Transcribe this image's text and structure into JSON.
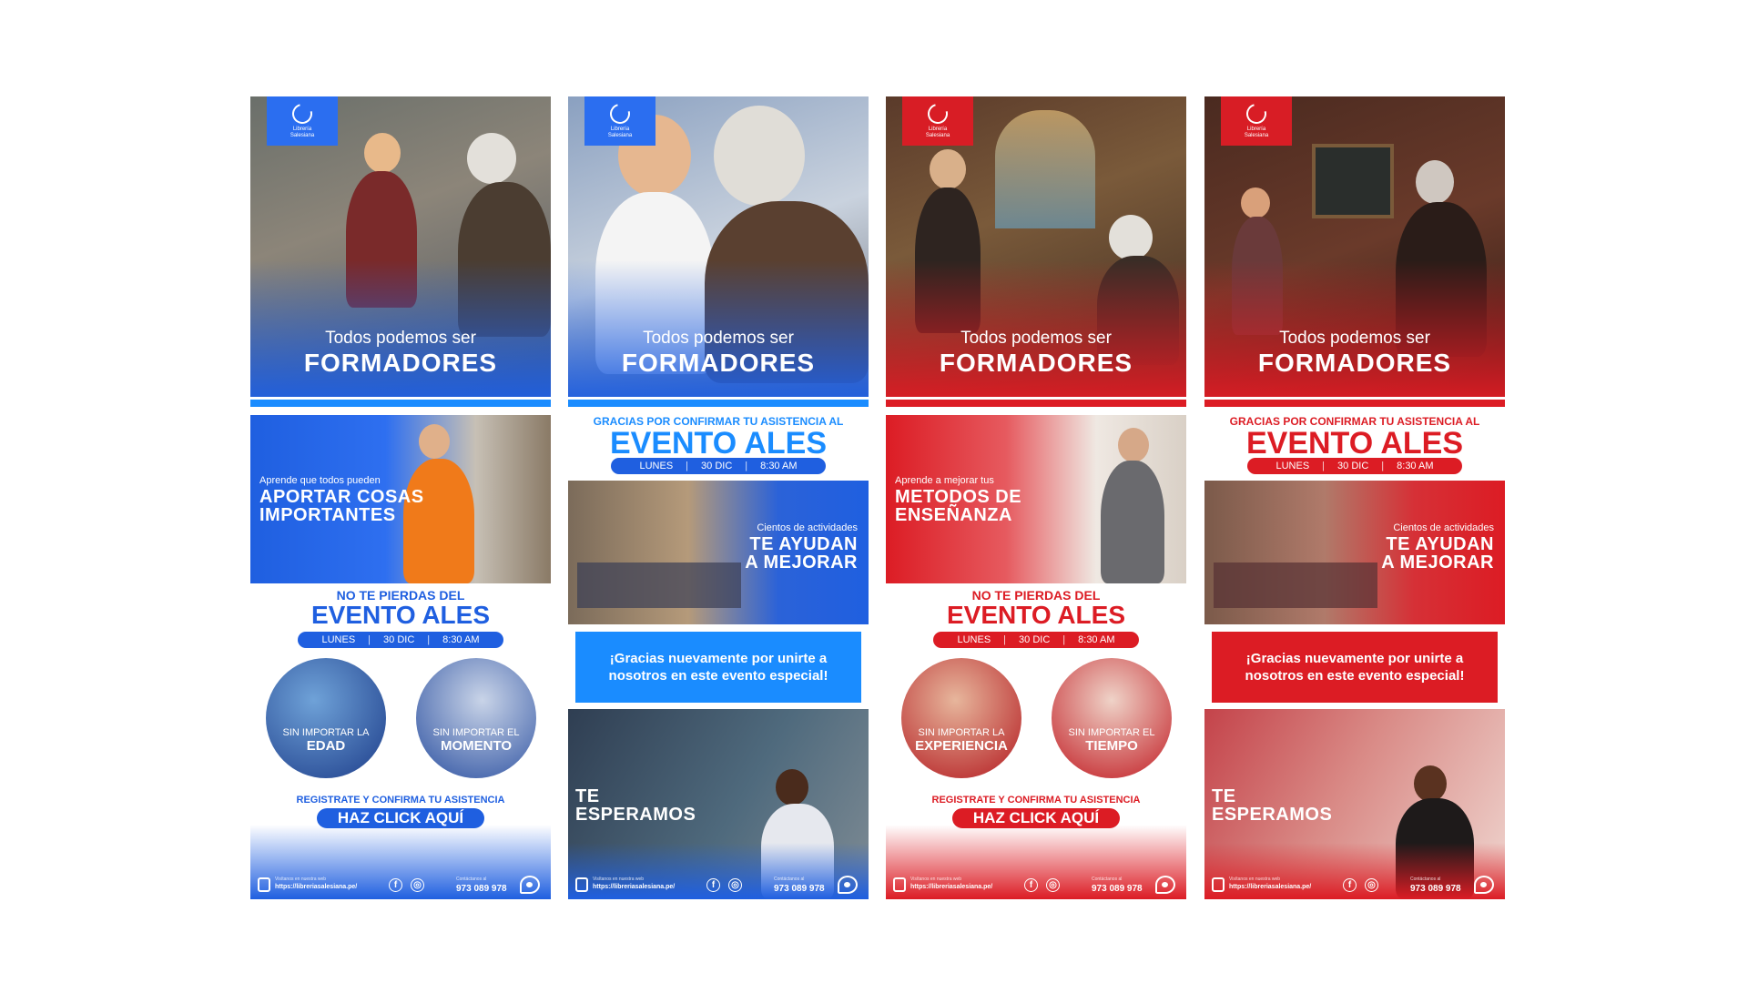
{
  "colors": {
    "blue": "#1f5fe0",
    "lightblue": "#1a8cff",
    "red": "#dc1c24",
    "white": "#ffffff"
  },
  "logo": {
    "line1": "Librería",
    "line2": "Salesiana"
  },
  "hero": {
    "sub": "Todos podemos ser",
    "big": "FORMADORES"
  },
  "col1": {
    "promo_small": "Aprende que todos pueden",
    "promo_big1": "APORTAR COSAS",
    "promo_big2": "IMPORTANTES",
    "event_pre": "NO TE PIERDAS DEL",
    "event_title": "EVENTO ALES",
    "day": "LUNES",
    "date": "30 DIC",
    "time": "8:30 AM",
    "circle1_small": "SIN IMPORTAR LA",
    "circle1_big": "EDAD",
    "circle2_small": "SIN IMPORTAR EL",
    "circle2_big": "MOMENTO",
    "register": "REGISTRATE Y CONFIRMA TU ASISTENCIA",
    "cta": "HAZ CLICK AQUÍ"
  },
  "col2": {
    "event_pre": "GRACIAS POR CONFIRMAR TU ASISTENCIA AL",
    "event_title": "EVENTO ALES",
    "day": "LUNES",
    "date": "30 DIC",
    "time": "8:30 AM",
    "act_small": "Cientos de actividades",
    "act_big1": "TE AYUDAN",
    "act_big2": "A MEJORAR",
    "thanks": "¡Gracias nuevamente por unirte a nosotros en este evento especial!",
    "wait1": "TE",
    "wait2": "ESPERAMOS"
  },
  "col3": {
    "promo_small": "Aprende a mejorar tus",
    "promo_big1": "METODOS DE",
    "promo_big2": "ENSEÑANZA",
    "event_pre": "NO TE PIERDAS DEL",
    "event_title": "EVENTO ALES",
    "day": "LUNES",
    "date": "30 DIC",
    "time": "8:30 AM",
    "circle1_small": "SIN IMPORTAR LA",
    "circle1_big": "EXPERIENCIA",
    "circle2_small": "SIN IMPORTAR EL",
    "circle2_big": "TIEMPO",
    "register": "REGISTRATE Y CONFIRMA TU ASISTENCIA",
    "cta": "HAZ CLICK AQUÍ"
  },
  "col4": {
    "event_pre": "GRACIAS POR CONFIRMAR TU ASISTENCIA AL",
    "event_title": "EVENTO ALES",
    "day": "LUNES",
    "date": "30 DIC",
    "time": "8:30 AM",
    "act_small": "Cientos de actividades",
    "act_big1": "TE AYUDAN",
    "act_big2": "A MEJORAR",
    "thanks": "¡Gracias nuevamente por unirte a nosotros en este evento especial!",
    "wait1": "TE",
    "wait2": "ESPERAMOS"
  },
  "footer": {
    "web_label": "Visítanos en nuestra web",
    "web": "https://libreriasalesiana.pe/",
    "phone_label": "Contáctanos al",
    "phone": "973 089 978"
  },
  "icons": [
    "logo-icon",
    "web-icon",
    "facebook-icon",
    "instagram-icon",
    "eye-icon"
  ]
}
